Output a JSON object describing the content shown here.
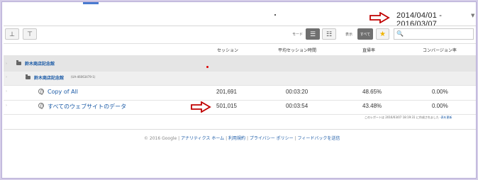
{
  "header": {
    "date_range": "2014/04/01 - 2016/03/07"
  },
  "toolbar": {
    "btn1_glyph": "⊥",
    "btn2_glyph": "⊤",
    "mode_label": "モード",
    "mode_on_glyph": "☰",
    "mode_off_glyph": "☷",
    "view_label": "表示",
    "all_label": "すべて",
    "star_glyph": "★",
    "search_glyph": "🔍"
  },
  "table": {
    "columns": [
      "セッション",
      "平均セッション時間",
      "直帰率",
      "コンバージョン率"
    ],
    "account": {
      "name": "鈴木商店記念館"
    },
    "property": {
      "name": "鈴木商店記念館",
      "id": "(UA-46063479-1)"
    },
    "rows": [
      {
        "name": "Copy of All",
        "sessions": "201,691",
        "avg_time": "00:03:20",
        "bounce": "48.65%",
        "conversion": "0.00%"
      },
      {
        "name": "すべてのウェブサイトのデータ",
        "sessions": "501,015",
        "avg_time": "00:03:54",
        "bounce": "43.48%",
        "conversion": "0.00%"
      }
    ]
  },
  "footnote": {
    "text": "このレポートは 2016/03/07 18:19:31 に作成されました -",
    "link": "表を更新"
  },
  "footer": {
    "copyright": "© 2016 Google",
    "links": [
      "アナリティクス ホーム",
      "利用規約",
      "プライバシー ポリシー",
      "フィードバックを送信"
    ],
    "sep": " | "
  },
  "colors": {
    "annotation_arrow": "#c00000",
    "link": "#1a5aa6"
  }
}
